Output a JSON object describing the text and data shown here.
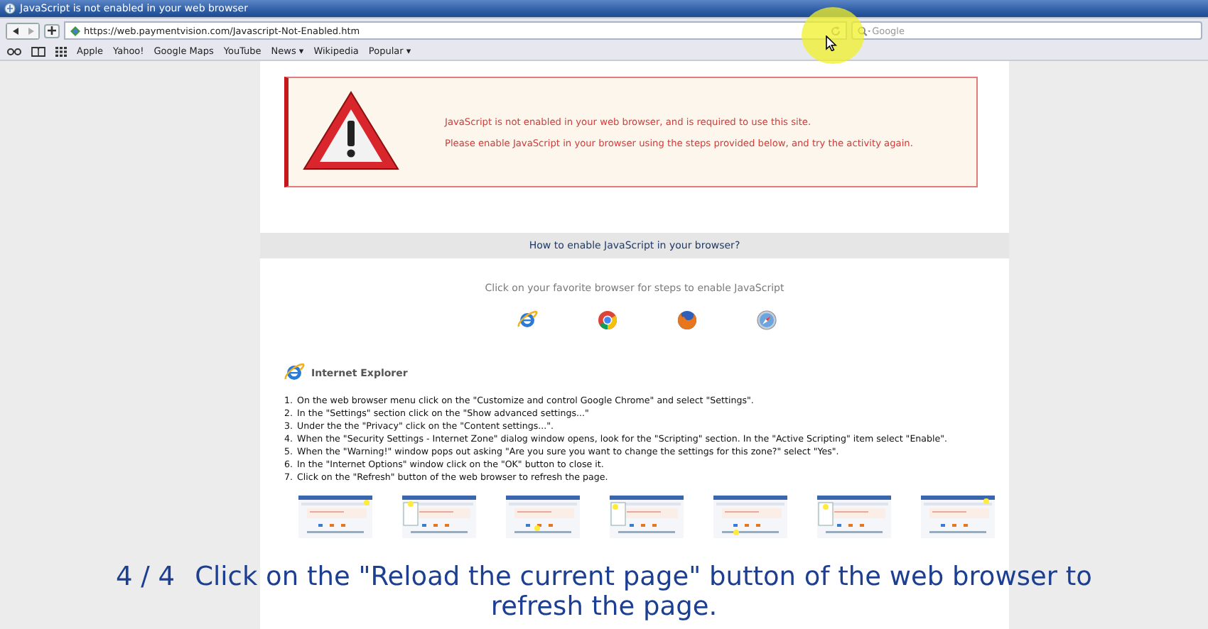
{
  "window": {
    "title": "JavaScript is not enabled in your web browser"
  },
  "toolbar": {
    "url": "https://web.paymentvision.com/Javascript-Not-Enabled.htm",
    "search": {
      "placeholder": "Google"
    }
  },
  "bookmarks": [
    {
      "label": "Apple"
    },
    {
      "label": "Yahoo!"
    },
    {
      "label": "Google Maps"
    },
    {
      "label": "YouTube"
    },
    {
      "label": "News ▾"
    },
    {
      "label": "Wikipedia"
    },
    {
      "label": "Popular ▾"
    }
  ],
  "alert": {
    "lines": [
      "JavaScript is not enabled in your web browser, and is required to use this site.",
      "Please enable JavaScript in your browser using the steps provided below, and try the activity again."
    ]
  },
  "help": {
    "heading": "How to enable JavaScript in your browser?",
    "subtitle": "Click on your favorite browser for steps to enable JavaScript",
    "browsers": [
      {
        "kind": "ie"
      },
      {
        "kind": "chrome"
      },
      {
        "kind": "firefox"
      },
      {
        "kind": "safari"
      }
    ]
  },
  "section": {
    "title": "Internet Explorer",
    "steps": [
      {
        "number": "1.",
        "text": "On the web browser menu click on the \"Customize and control Google Chrome\" and select \"Settings\"."
      },
      {
        "number": "2.",
        "text": "In the \"Settings\" section click on the \"Show advanced settings...\""
      },
      {
        "number": "3.",
        "text": "Under the the \"Privacy\" click on the \"Content settings...\"."
      },
      {
        "number": "4.",
        "text": "When the \"Security Settings - Internet Zone\" dialog window opens, look for the \"Scripting\" section. In the \"Active Scripting\" item select \"Enable\"."
      },
      {
        "number": "5.",
        "text": "When the \"Warning!\" window pops out asking \"Are you sure you want to change the settings for this zone?\" select \"Yes\"."
      },
      {
        "number": "6.",
        "text": "In the \"Internet Options\" window click on the \"OK\" button to close it."
      },
      {
        "number": "7.",
        "text": "Click on the \"Refresh\" button of the web browser to refresh the page."
      }
    ]
  },
  "caption": {
    "counter": "4 / 4",
    "text": "Click on the \"Reload the current page\" button of the web browser to refresh the page."
  }
}
